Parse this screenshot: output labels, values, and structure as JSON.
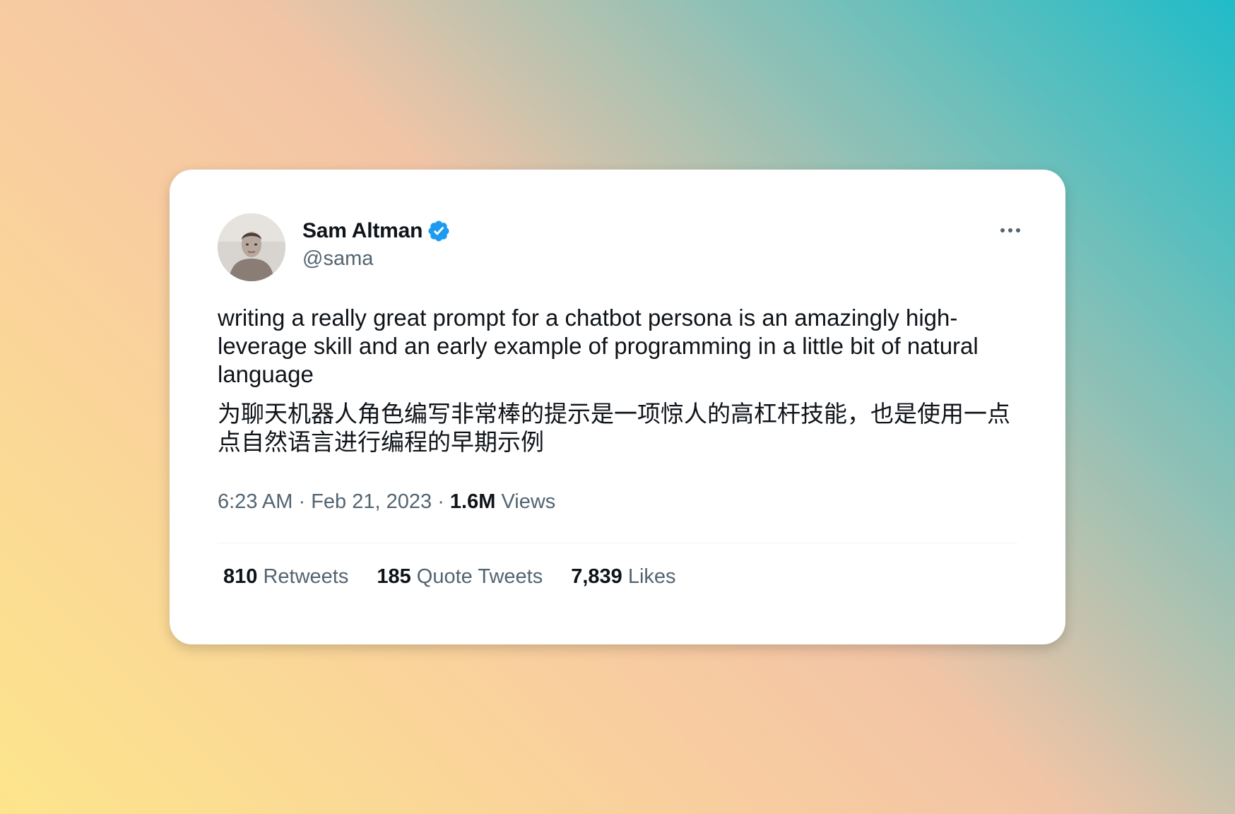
{
  "author": {
    "display_name": "Sam Altman",
    "handle": "@sama",
    "verified": true,
    "verified_color": "#1d9bf0"
  },
  "tweet": {
    "text_en": "writing a really great prompt for a chatbot persona is an amazingly high-leverage skill and an early example of programming in a little bit of natural language",
    "text_zh": "为聊天机器人角色编写非常棒的提示是一项惊人的高杠杆技能，也是使用一点点自然语言进行编程的早期示例"
  },
  "meta": {
    "time": "6:23 AM",
    "separator": "·",
    "date": "Feb 21, 2023",
    "views_count": "1.6M",
    "views_label": "Views"
  },
  "stats": {
    "retweets_count": "810",
    "retweets_label": "Retweets",
    "quotes_count": "185",
    "quotes_label": "Quote Tweets",
    "likes_count": "7,839",
    "likes_label": "Likes"
  },
  "icons": {
    "more": "more-horizontal-icon",
    "verified": "verified-badge-icon"
  }
}
